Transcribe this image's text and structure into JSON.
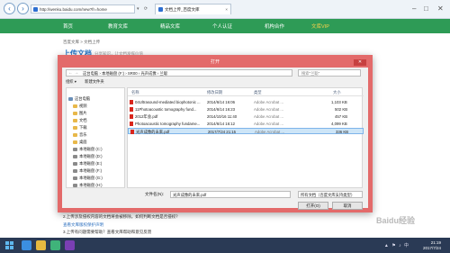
{
  "browser": {
    "url": "http://wenku.baidu.com/new?fr=home",
    "tab_title": "文档上传_百度文库",
    "tab_close": "×",
    "minimize": "–",
    "maximize": "□",
    "close": "✕",
    "back": "‹",
    "forward": "›"
  },
  "site": {
    "nav": [
      "首页",
      "教育文库",
      "精品文库",
      "个人认证",
      "机构合作"
    ],
    "vip": "文库VIP",
    "breadcrumb": "百度文库 > 文档上传",
    "upload_title": "上传文档",
    "upload_sub": "分享知识，让文档发挥价值",
    "notes": [
      "2.上传涉及侵权内容的文档将会被移除。如何判断文档是否侵权？",
      "查看文库版权保护声明",
      "3.上传有问题需要帮助？查看文库帮助和意见反馈"
    ]
  },
  "dialog": {
    "title": "打开",
    "close": "✕",
    "path": [
      "这台电脑",
      "本地磁盘 (F:)",
      "SR00",
      "光声成像",
      "兰聪"
    ],
    "search_placeholder": "搜索\"兰聪\"",
    "toolbar": [
      "组织 ▾",
      "新建文件夹"
    ],
    "tree": [
      {
        "label": "这台电脑",
        "type": "pc"
      },
      {
        "label": "视频",
        "type": "folder"
      },
      {
        "label": "图片",
        "type": "folder"
      },
      {
        "label": "文档",
        "type": "folder"
      },
      {
        "label": "下载",
        "type": "folder"
      },
      {
        "label": "音乐",
        "type": "folder"
      },
      {
        "label": "桌面",
        "type": "folder"
      },
      {
        "label": "本地磁盘 (C:)",
        "type": "drive"
      },
      {
        "label": "本地磁盘 (D:)",
        "type": "drive"
      },
      {
        "label": "本地磁盘 (E:)",
        "type": "drive"
      },
      {
        "label": "本地磁盘 (F:)",
        "type": "drive"
      },
      {
        "label": "本地磁盘 (G:)",
        "type": "drive"
      },
      {
        "label": "本地磁盘 (H:)",
        "type": "drive"
      }
    ],
    "columns": [
      "名称",
      "修改日期",
      "类型",
      "大小"
    ],
    "files": [
      {
        "name": "04Ultrasound-mediated biophotonic ...",
        "date": "2014/6/14 16:06",
        "type": "Adobe Acrobat ...",
        "size": "1,103 KB",
        "selected": false
      },
      {
        "name": "11Photoacoustic tomography fund...",
        "date": "2014/6/14 16:23",
        "type": "Adobe Acrobat ...",
        "size": "502 KB",
        "selected": false
      },
      {
        "name": "2012年会.pdf",
        "date": "2014/10/16 11:40",
        "type": "Adobe Acrobat ...",
        "size": "457 KB",
        "selected": false
      },
      {
        "name": "Photoacoustic tomography fundame...",
        "date": "2014/6/14 16:12",
        "type": "Adobe Acrobat ...",
        "size": "4,099 KB",
        "selected": false
      },
      {
        "name": "光声成像的未来.pdf",
        "date": "2017/7/24 21:15",
        "type": "Adobe Acrobat ...",
        "size": "336 KB",
        "selected": true
      }
    ],
    "filename_label": "文件名(N):",
    "filename_value": "光声成像的未来.pdf",
    "filetype_value": "所有文档（百度文库支持类型）",
    "open_button": "打开(O)",
    "cancel_button": "取消"
  },
  "taskbar": {
    "time": "21:19",
    "date": "2017/7/24"
  },
  "watermark": "Baidu经验"
}
